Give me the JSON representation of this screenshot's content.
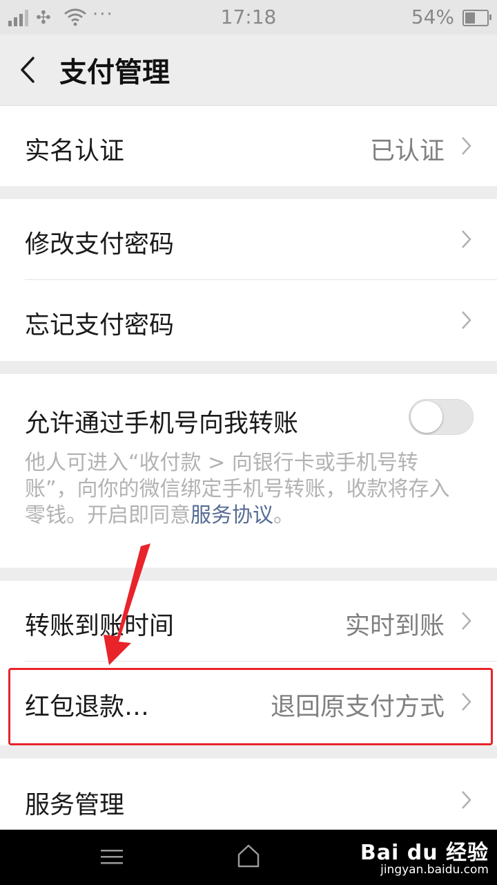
{
  "status_bar": {
    "time": "17:18",
    "battery_percent": "54%",
    "battery_level": 0.54,
    "carrier_icon": "unicom-logo-icon",
    "more": "···"
  },
  "header": {
    "title": "支付管理"
  },
  "settings": {
    "real_name": {
      "label": "实名认证",
      "value": "已认证"
    },
    "change_password": {
      "label": "修改支付密码"
    },
    "forgot_password": {
      "label": "忘记支付密码"
    },
    "phone_transfer": {
      "label": "允许通过手机号向我转账",
      "enabled": false,
      "description": "他人可进入“收付款 > 向银行卡或手机号转账”，向你的微信绑定手机号转账，收款将存入零钱。开启即同意",
      "link": "服务协议",
      "description_end": "。"
    },
    "transfer_time": {
      "label": "转账到账时间",
      "value": "实时到账"
    },
    "red_packet_refund": {
      "label": "红包退款…",
      "value": "退回原支付方式"
    },
    "service_management": {
      "label": "服务管理"
    }
  },
  "watermark": {
    "logo": "Bai du 经验",
    "url": "jingyan.baidu.com"
  },
  "colors": {
    "highlight": "#e8232a",
    "link": "#576b95",
    "background": "#ededed"
  }
}
